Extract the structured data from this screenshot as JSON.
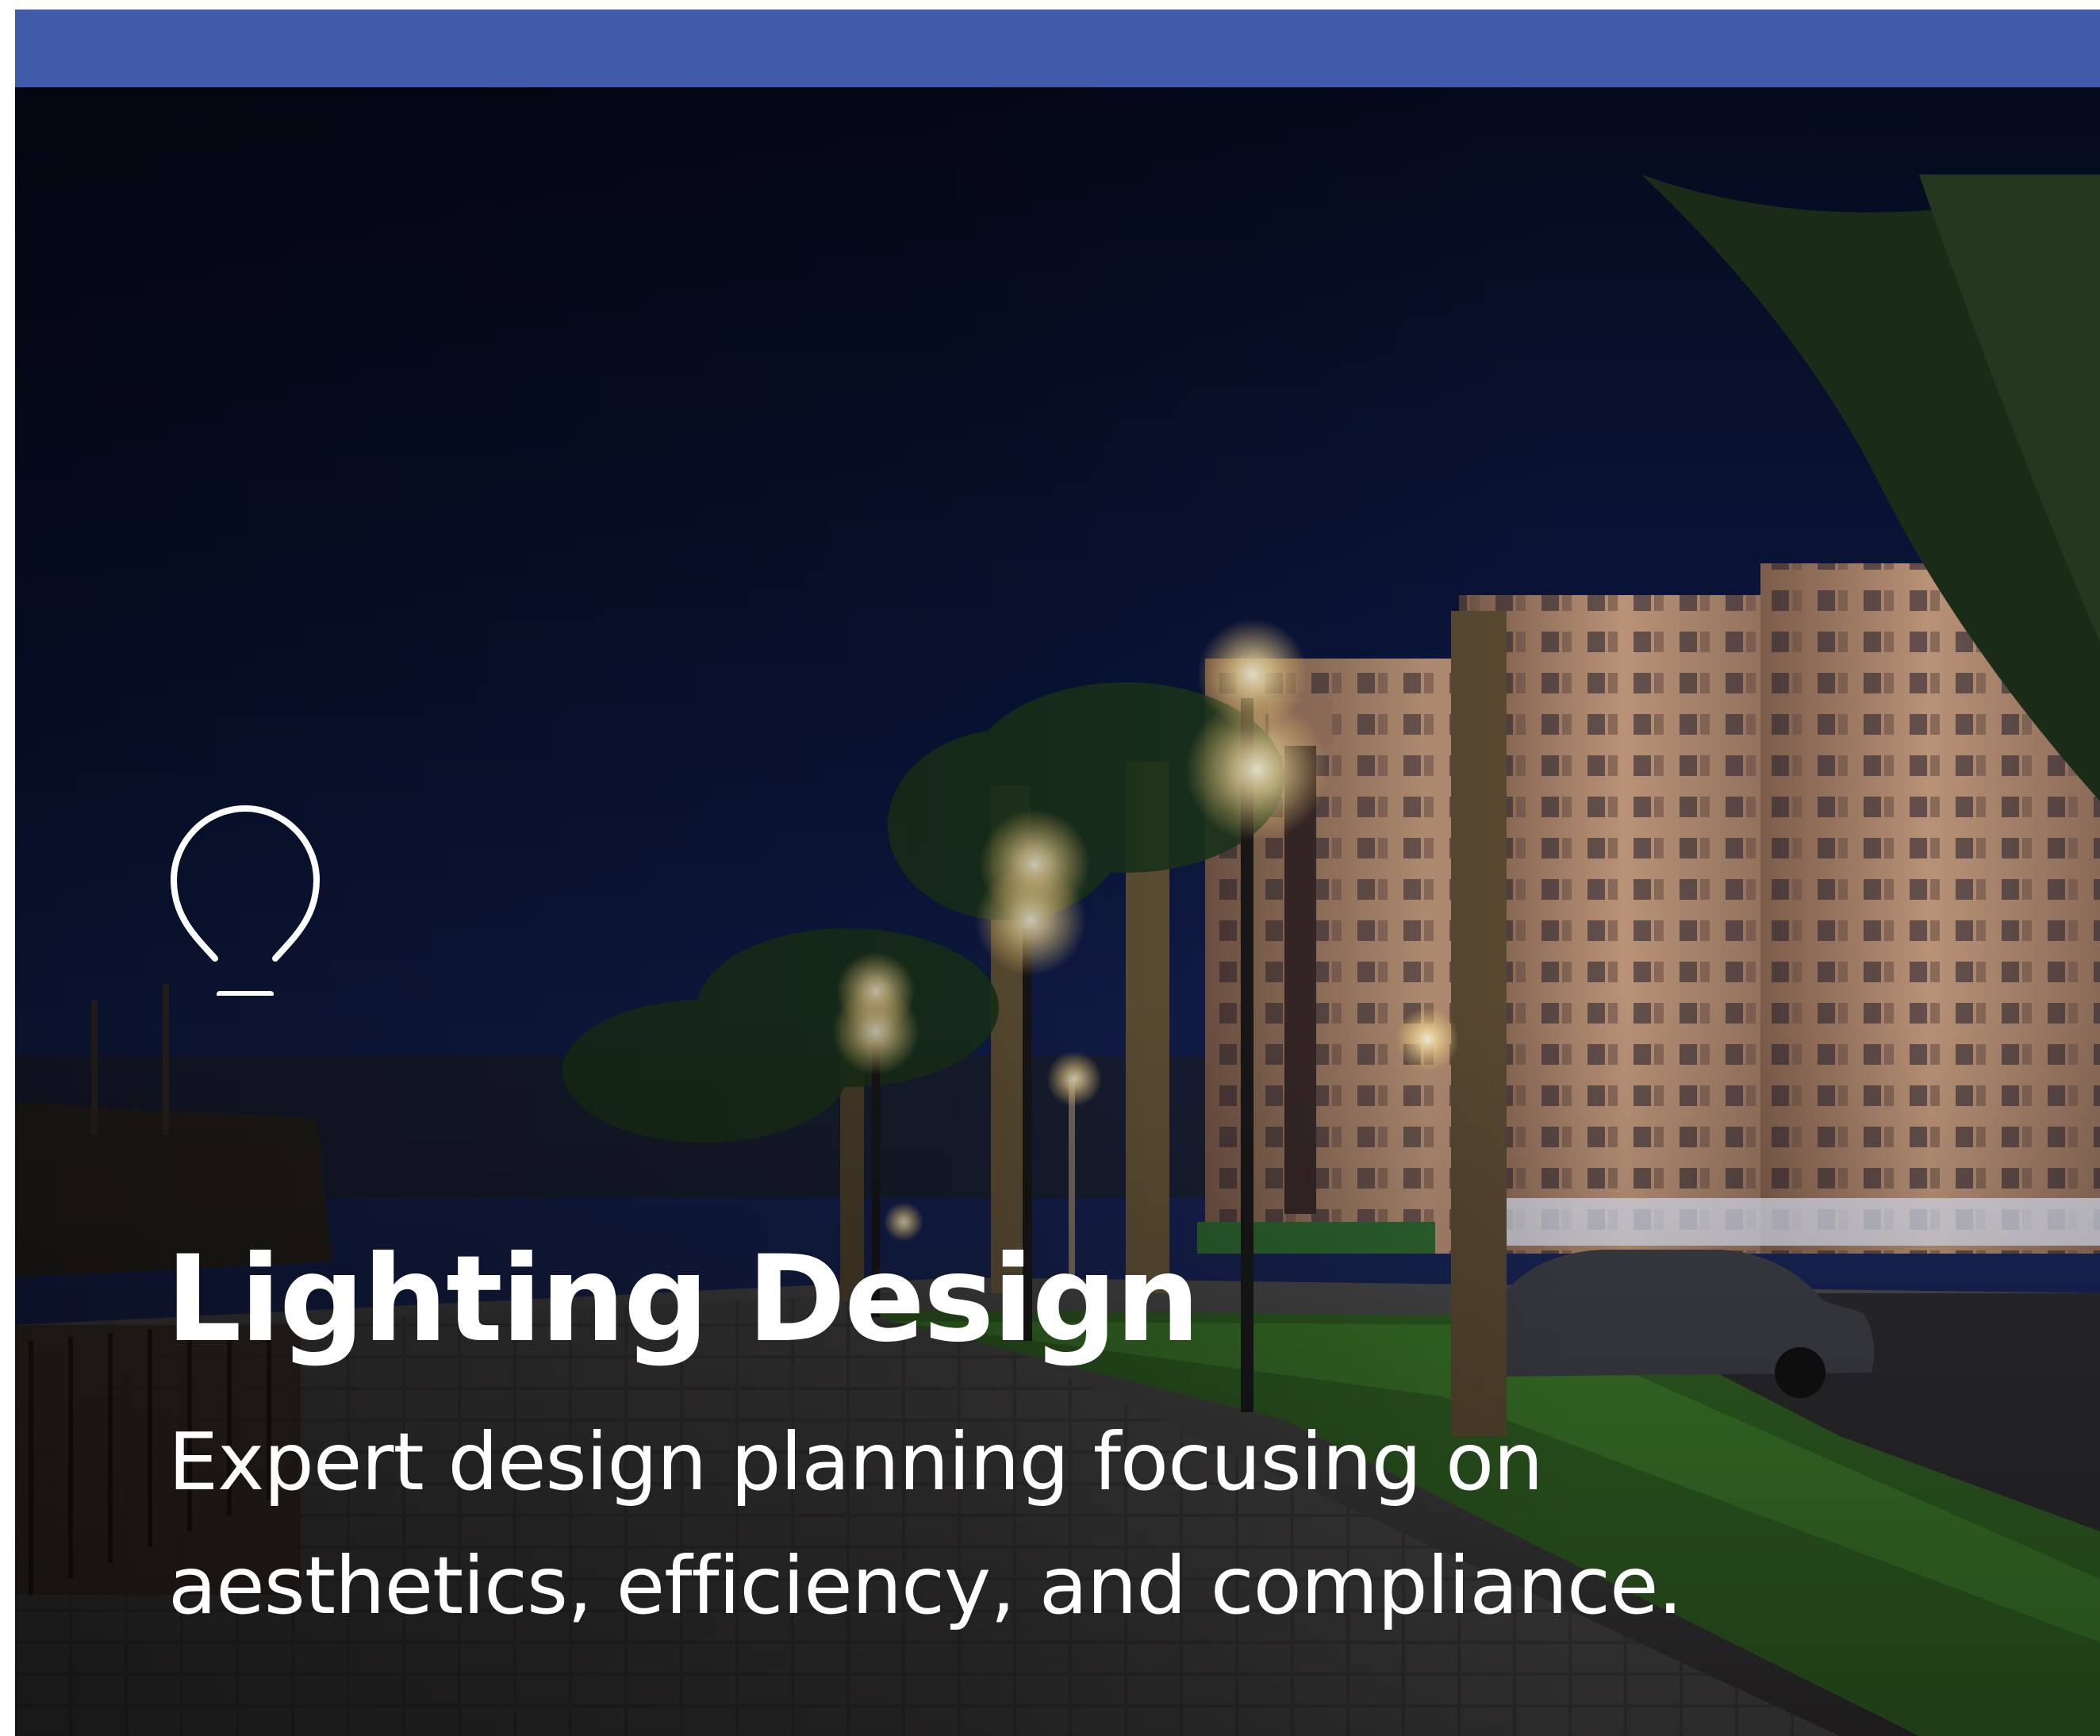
{
  "colors": {
    "top_bar": "#3f5ba9",
    "text": "#ffffff",
    "sky": "#0a1333"
  },
  "hero": {
    "background_image": "night-promenade-with-street-lamps-palms-and-apartment-buildings",
    "icon": "lightbulb-icon",
    "title": "Lighting Design",
    "description": "Expert design planning focusing on aesthetics, efficiency, and compliance."
  }
}
